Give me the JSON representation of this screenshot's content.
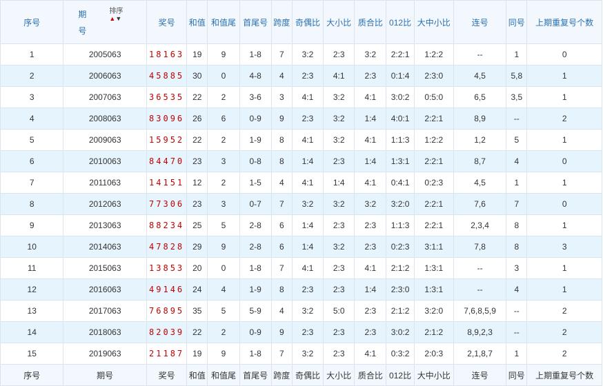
{
  "headers": [
    "序号",
    "期号",
    "奖号",
    "和值",
    "和值尾",
    "首尾号",
    "跨度",
    "奇偶比",
    "大小比",
    "质合比",
    "012比",
    "大中小比",
    "连号",
    "同号",
    "上期重复号个数"
  ],
  "issue_header": {
    "chars": [
      "期",
      "号"
    ],
    "sort_label": "排序"
  },
  "rows": [
    [
      "1",
      "2005063",
      "18163",
      "19",
      "9",
      "1-8",
      "7",
      "3:2",
      "2:3",
      "3:2",
      "2:2:1",
      "1:2:2",
      "--",
      "1",
      "0"
    ],
    [
      "2",
      "2006063",
      "45885",
      "30",
      "0",
      "4-8",
      "4",
      "2:3",
      "4:1",
      "2:3",
      "0:1:4",
      "2:3:0",
      "4,5",
      "5,8",
      "1"
    ],
    [
      "3",
      "2007063",
      "36535",
      "22",
      "2",
      "3-6",
      "3",
      "4:1",
      "3:2",
      "4:1",
      "3:0:2",
      "0:5:0",
      "6,5",
      "3,5",
      "1"
    ],
    [
      "4",
      "2008063",
      "83096",
      "26",
      "6",
      "0-9",
      "9",
      "2:3",
      "3:2",
      "1:4",
      "4:0:1",
      "2:2:1",
      "8,9",
      "--",
      "2"
    ],
    [
      "5",
      "2009063",
      "15952",
      "22",
      "2",
      "1-9",
      "8",
      "4:1",
      "3:2",
      "4:1",
      "1:1:3",
      "1:2:2",
      "1,2",
      "5",
      "1"
    ],
    [
      "6",
      "2010063",
      "84470",
      "23",
      "3",
      "0-8",
      "8",
      "1:4",
      "2:3",
      "1:4",
      "1:3:1",
      "2:2:1",
      "8,7",
      "4",
      "0"
    ],
    [
      "7",
      "2011063",
      "14151",
      "12",
      "2",
      "1-5",
      "4",
      "4:1",
      "1:4",
      "4:1",
      "0:4:1",
      "0:2:3",
      "4,5",
      "1",
      "1"
    ],
    [
      "8",
      "2012063",
      "77306",
      "23",
      "3",
      "0-7",
      "7",
      "3:2",
      "3:2",
      "3:2",
      "3:2:0",
      "2:2:1",
      "7,6",
      "7",
      "0"
    ],
    [
      "9",
      "2013063",
      "88234",
      "25",
      "5",
      "2-8",
      "6",
      "1:4",
      "2:3",
      "2:3",
      "1:1:3",
      "2:2:1",
      "2,3,4",
      "8",
      "1"
    ],
    [
      "10",
      "2014063",
      "47828",
      "29",
      "9",
      "2-8",
      "6",
      "1:4",
      "3:2",
      "2:3",
      "0:2:3",
      "3:1:1",
      "7,8",
      "8",
      "3"
    ],
    [
      "11",
      "2015063",
      "13853",
      "20",
      "0",
      "1-8",
      "7",
      "4:1",
      "2:3",
      "4:1",
      "2:1:2",
      "1:3:1",
      "--",
      "3",
      "1"
    ],
    [
      "12",
      "2016063",
      "49146",
      "24",
      "4",
      "1-9",
      "8",
      "2:3",
      "2:3",
      "1:4",
      "2:3:0",
      "1:3:1",
      "--",
      "4",
      "1"
    ],
    [
      "13",
      "2017063",
      "76895",
      "35",
      "5",
      "5-9",
      "4",
      "3:2",
      "5:0",
      "2:3",
      "2:1:2",
      "3:2:0",
      "7,6,8,5,9",
      "--",
      "2"
    ],
    [
      "14",
      "2018063",
      "82039",
      "22",
      "2",
      "0-9",
      "9",
      "2:3",
      "2:3",
      "2:3",
      "3:0:2",
      "2:1:2",
      "8,9,2,3",
      "--",
      "2"
    ],
    [
      "15",
      "2019063",
      "21187",
      "19",
      "9",
      "1-8",
      "7",
      "3:2",
      "2:3",
      "4:1",
      "0:3:2",
      "2:0:3",
      "2,1,8,7",
      "1",
      "2"
    ]
  ]
}
